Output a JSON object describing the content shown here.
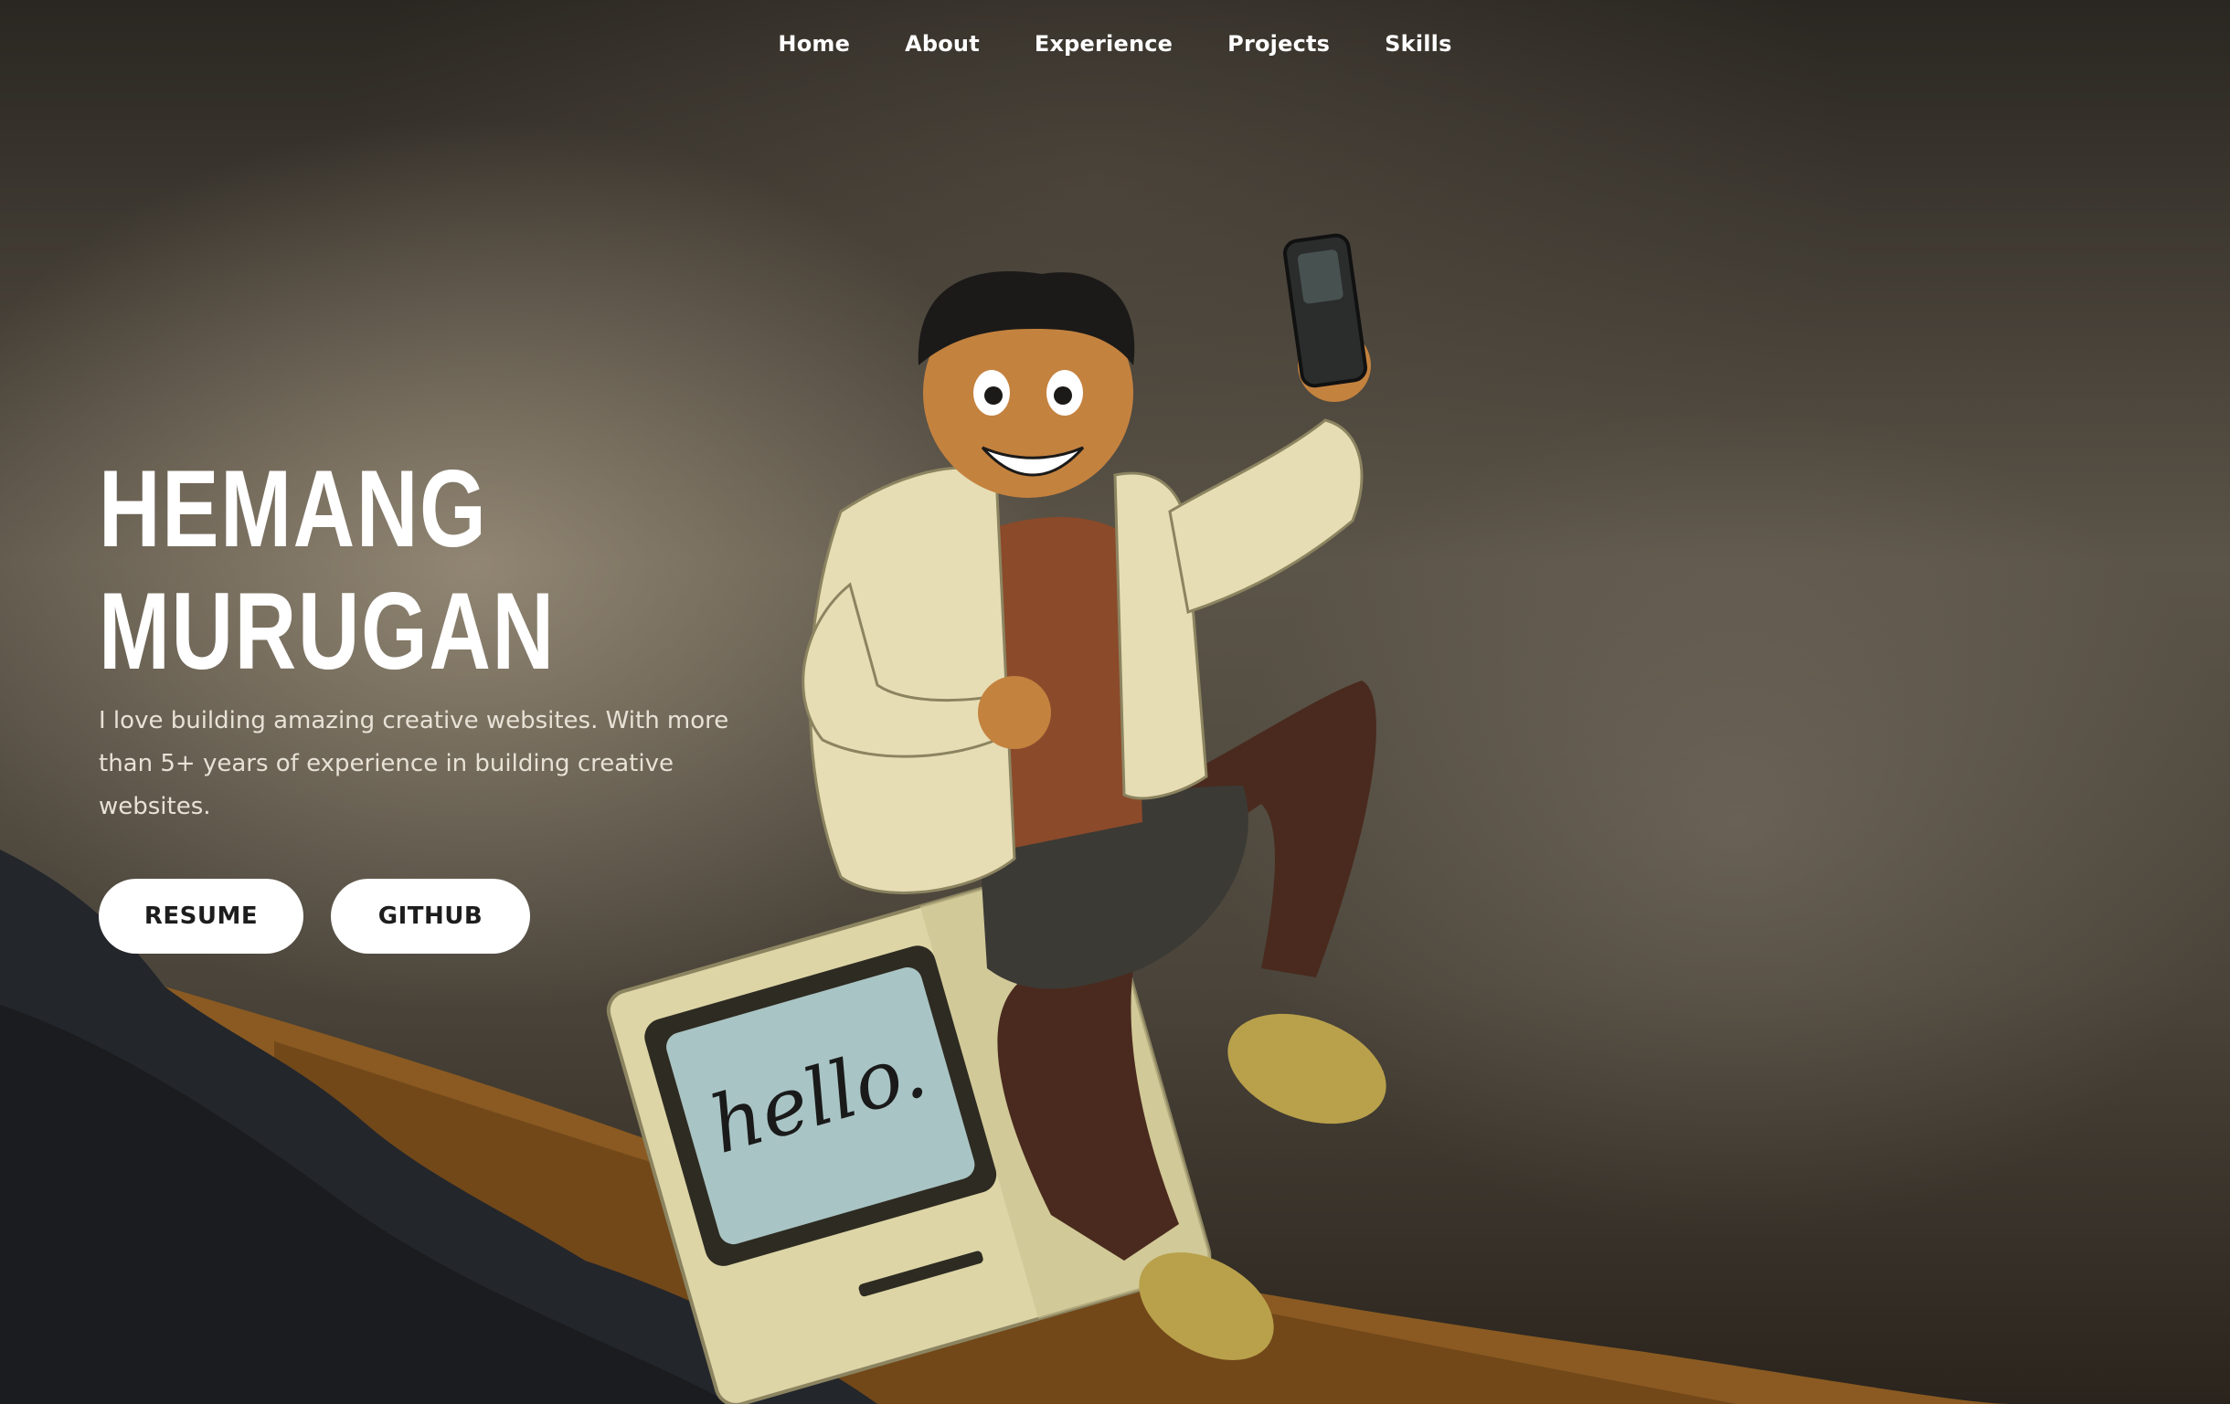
{
  "nav": {
    "items": [
      {
        "label": "Home"
      },
      {
        "label": "About"
      },
      {
        "label": "Experience"
      },
      {
        "label": "Projects"
      },
      {
        "label": "Skills"
      }
    ]
  },
  "hero": {
    "name_line1": "HEMANG",
    "name_line2": "MURUGAN",
    "bio": "I love building amazing creative websites. With more than 5+ years of experience in building creative websites.",
    "buttons": {
      "resume": "RESUME",
      "github": "GITHUB"
    },
    "illustration": {
      "screen_text": "hello."
    }
  },
  "colors": {
    "button_bg": "#ffffff",
    "button_text": "#1d1d1d",
    "text": "#ffffff"
  }
}
